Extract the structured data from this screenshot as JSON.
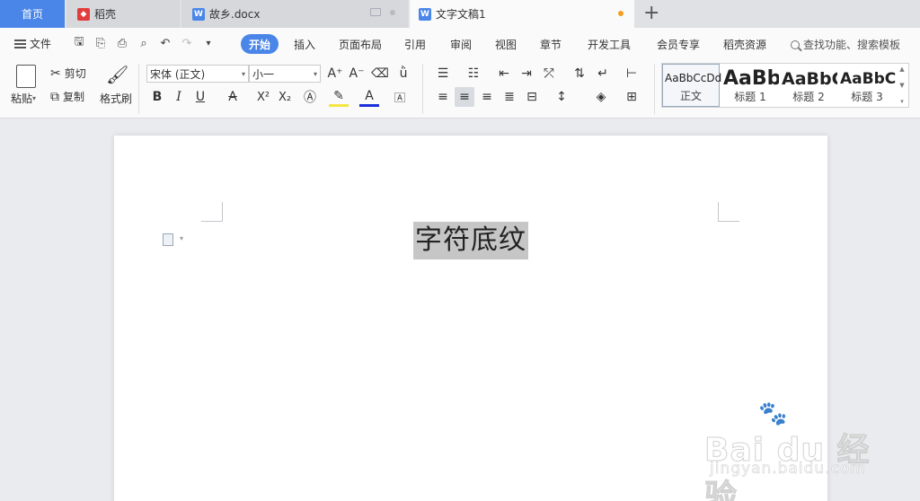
{
  "tabs": {
    "home": "首页",
    "daoke": "稻壳",
    "guxiang": "故乡.docx",
    "active": "文字文稿1"
  },
  "menu": {
    "file": "文件",
    "active_tab": "开始",
    "items": [
      "插入",
      "页面布局",
      "引用",
      "审阅",
      "视图",
      "章节",
      "开发工具",
      "会员专享",
      "稻壳资源"
    ],
    "search": "查找功能、搜索模板"
  },
  "ribbon": {
    "paste": "粘贴",
    "cut": "剪切",
    "copy": "复制",
    "format_painter": "格式刷",
    "font_name": "宋体 (正文)",
    "font_size": "小一",
    "styles": [
      {
        "preview": "AaBbCcDd",
        "label": "正文"
      },
      {
        "preview": "AaBb",
        "label": "标题 1"
      },
      {
        "preview": "AaBbC",
        "label": "标题 2"
      },
      {
        "preview": "AaBbC",
        "label": "标题 3"
      }
    ]
  },
  "document": {
    "text": "字符底纹"
  },
  "watermark": {
    "main": "Bai du 经验",
    "sub": "jingyan.baidu.com"
  },
  "colors": {
    "accent": "#4a86e8",
    "tab_bar": "#dfe1e5",
    "highlight": "#c6c6c6",
    "unsaved_dot": "#f0a020"
  }
}
